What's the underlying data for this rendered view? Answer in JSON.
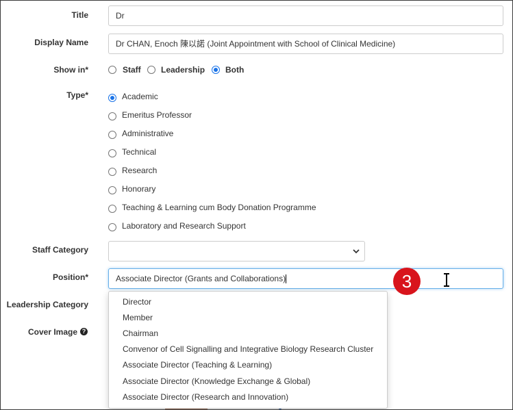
{
  "title_field": {
    "label": "Title",
    "value": "Dr"
  },
  "display_name_field": {
    "label": "Display Name",
    "value": "Dr CHAN, Enoch 陳以諾 (Joint Appointment with School of Clinical Medicine)"
  },
  "show_in": {
    "label": "Show in*",
    "options": [
      {
        "label": "Staff",
        "checked": false
      },
      {
        "label": "Leadership",
        "checked": false
      },
      {
        "label": "Both",
        "checked": true
      }
    ]
  },
  "type": {
    "label": "Type*",
    "options": [
      {
        "label": "Academic",
        "checked": true
      },
      {
        "label": "Emeritus Professor",
        "checked": false
      },
      {
        "label": "Administrative",
        "checked": false
      },
      {
        "label": "Technical",
        "checked": false
      },
      {
        "label": "Research",
        "checked": false
      },
      {
        "label": "Honorary",
        "checked": false
      },
      {
        "label": "Teaching & Learning cum Body Donation Programme",
        "checked": false
      },
      {
        "label": "Laboratory and Research Support",
        "checked": false
      }
    ]
  },
  "staff_category": {
    "label": "Staff Category",
    "value": ""
  },
  "position": {
    "label": "Position*",
    "value": "Associate Director (Grants and Collaborations)",
    "suggestions": [
      "Director",
      "Member",
      "Chairman",
      "Convenor of Cell Signalling and Integrative Biology Research Cluster",
      "Associate Director (Teaching & Learning)",
      "Associate Director (Knowledge Exchange & Global)",
      "Associate Director (Research and Innovation)"
    ]
  },
  "leadership_category": {
    "label": "Leadership Category"
  },
  "cover_image": {
    "label": "Cover Image",
    "help_icon": "question-circle-icon"
  },
  "step_badge": {
    "number": "3",
    "color": "#d8141c"
  },
  "colors": {
    "accent": "#1a73e8",
    "focus_border": "#66afe9"
  }
}
